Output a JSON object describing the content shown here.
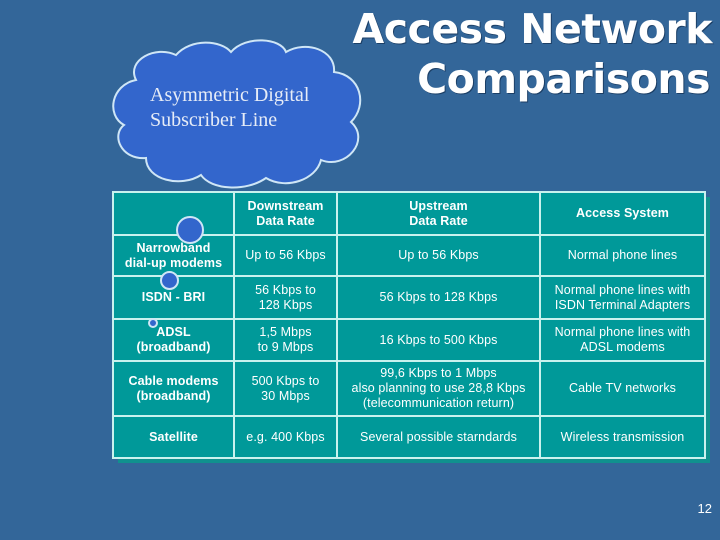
{
  "slide": {
    "title_line1": "Access Network",
    "title_line2": "Comparisons",
    "callout": {
      "line1": "Asymmetric Digital",
      "line2": "Subscriber Line"
    },
    "page_number": "12"
  },
  "colors": {
    "background": "#336699",
    "cloud_fill": "#3366cc",
    "table_fill": "#009999",
    "table_border": "#c9f2ee",
    "text": "#ffffff"
  },
  "table": {
    "headers": [
      "",
      "Downstream\nData Rate",
      "Upstream\nData Rate",
      "Access System"
    ],
    "rows": [
      [
        "Narrowband\ndial-up modems",
        "Up to 56 Kbps",
        "Up to 56 Kbps",
        "Normal phone lines"
      ],
      [
        "ISDN - BRI",
        "56 Kbps to\n128 Kbps",
        "56 Kbps to 128 Kbps",
        "Normal phone lines with\nISDN Terminal Adapters"
      ],
      [
        "ADSL\n(broadband)",
        "1,5 Mbps\nto 9 Mbps",
        "16 Kbps to 500 Kbps",
        "Normal phone lines with\nADSL modems"
      ],
      [
        "Cable modems\n(broadband)",
        "500 Kbps to\n30 Mbps",
        "99,6 Kbps to 1 Mbps\nalso planning to use 28,8 Kbps\n(telecommunication return)",
        "Cable TV networks"
      ],
      [
        "Satellite",
        "e.g. 400 Kbps",
        "Several possible starndards",
        "Wireless transmission"
      ]
    ]
  }
}
